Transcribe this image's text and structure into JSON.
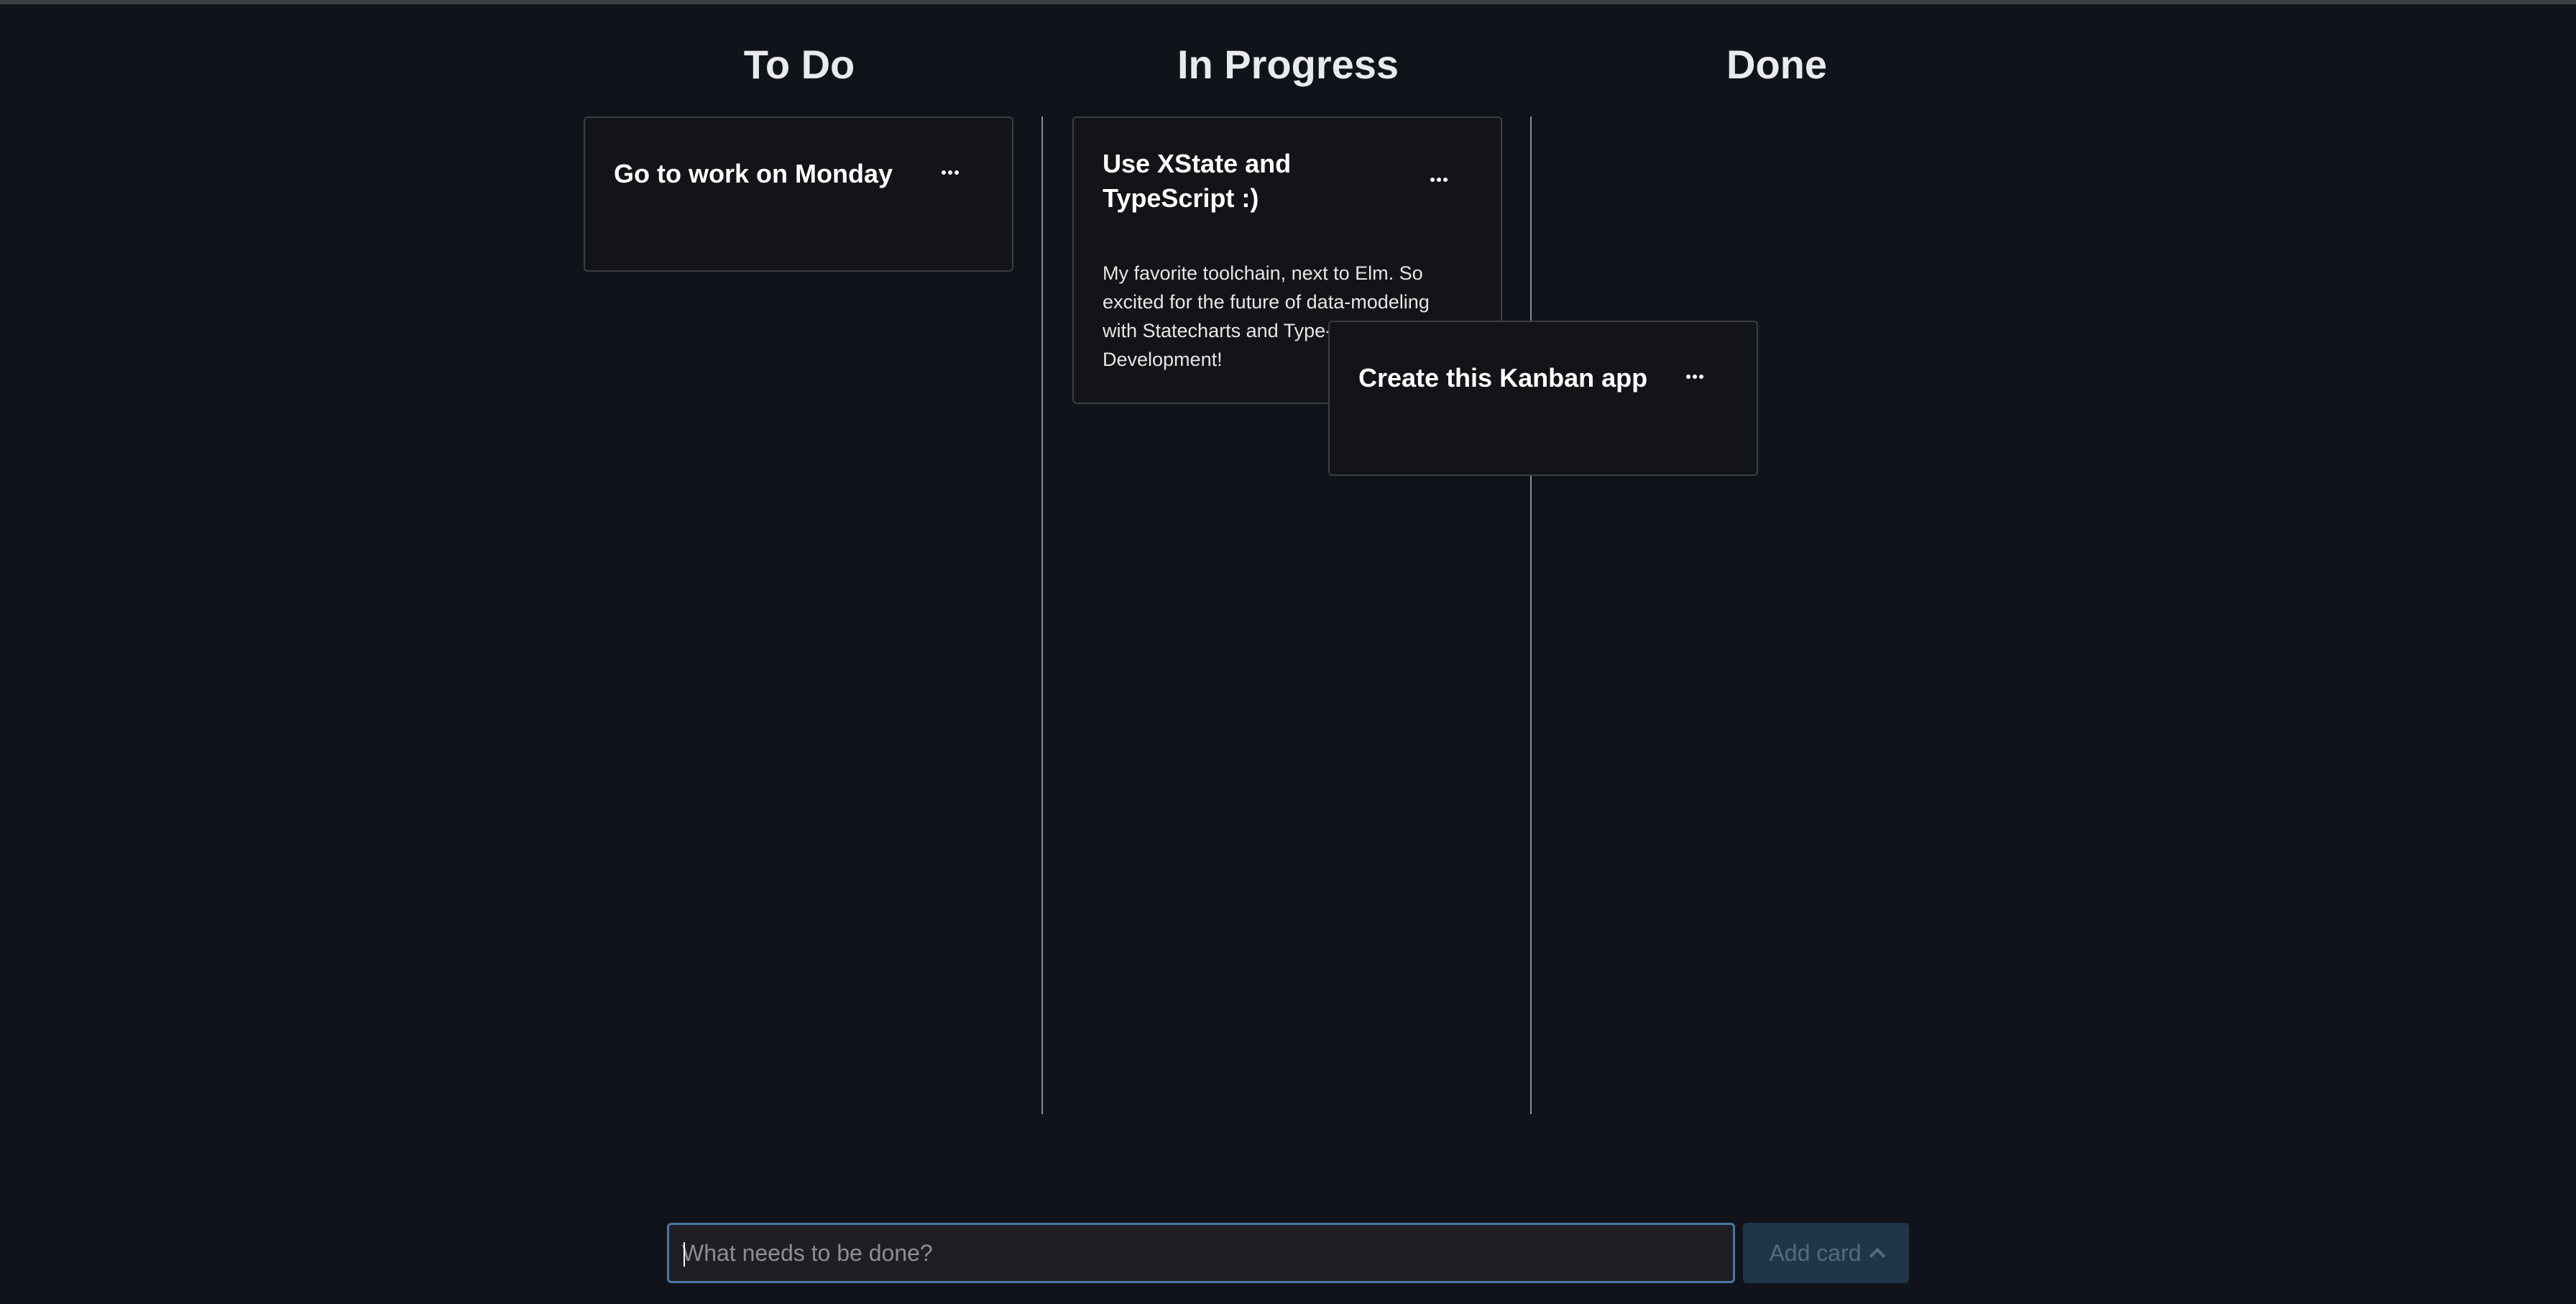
{
  "columns": [
    {
      "title": "To Do"
    },
    {
      "title": "In Progress"
    },
    {
      "title": "Done"
    }
  ],
  "cards": {
    "todo": [
      {
        "title": "Go to work on Monday"
      }
    ],
    "in_progress": [
      {
        "title": "Use XState and TypeScript :)",
        "description": "My favorite toolchain, next to Elm. So excited for the future of data-modeling with Statecharts and Type-Driven Development!"
      }
    ],
    "dragging": {
      "title": "Create this Kanban app"
    }
  },
  "new_card": {
    "placeholder": "What needs to be done?",
    "value": "",
    "add_label": "Add card"
  },
  "icons": {
    "card_menu": "ellipsis-icon",
    "add_button": "chevron-up-icon"
  },
  "colors": {
    "background": "#10141a",
    "card_border": "#3b3e44",
    "input_border": "#4a78a8",
    "add_button_bg": "#1f3549"
  }
}
